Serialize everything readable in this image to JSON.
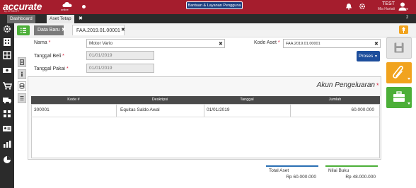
{
  "app": {
    "logo": "accurate",
    "logo_online": "online",
    "logo_sub": "by CPSSOFT",
    "help_button": "Bantuan & Layanan Pengguna",
    "user_name": "TEST",
    "user_sub": "Mia Hartati",
    "notif_count": "2"
  },
  "tabs": {
    "dashboard": "Dashboard",
    "aset_tetap": "Aset Tetap",
    "close": "✖"
  },
  "subtabs": {
    "data_baru": "Data Baru",
    "document": "FAA.2019.01.00001",
    "close": "✖"
  },
  "form": {
    "nama_label": "Nama",
    "nama_value": "Motor Vario",
    "kode_aset_label": "Kode Aset",
    "kode_aset_value": "FAA.2019.01.00001",
    "tanggal_beli_label": "Tanggal Beli",
    "tanggal_beli_value": "01/01/2019",
    "tanggal_pakai_label": "Tanggal Pakai",
    "tanggal_pakai_value": "01/01/2019",
    "required_mark": "*",
    "clear": "✖",
    "proses_button": "Proses"
  },
  "panel": {
    "title": "Akun Pengeluaran",
    "required_mark": "*",
    "columns": [
      "Kode #",
      "Deskripsi",
      "Tanggal",
      "Jumlah"
    ],
    "rows": [
      {
        "kode": "300001",
        "deskripsi": "Equitas Saldo Awal",
        "tanggal": "01/01/2019",
        "jumlah": "60.000.000"
      }
    ]
  },
  "footer": {
    "total_aset_label": "Total Aset",
    "total_aset_value": "Rp 60.000.000",
    "nilai_buku_label": "Nilai Buku",
    "nilai_buku_value": "Rp 48.000.000"
  },
  "colors": {
    "brand_red": "#a51d2d",
    "primary_blue": "#1d4e9c",
    "green": "#4caf38",
    "orange": "#f1a31e"
  }
}
